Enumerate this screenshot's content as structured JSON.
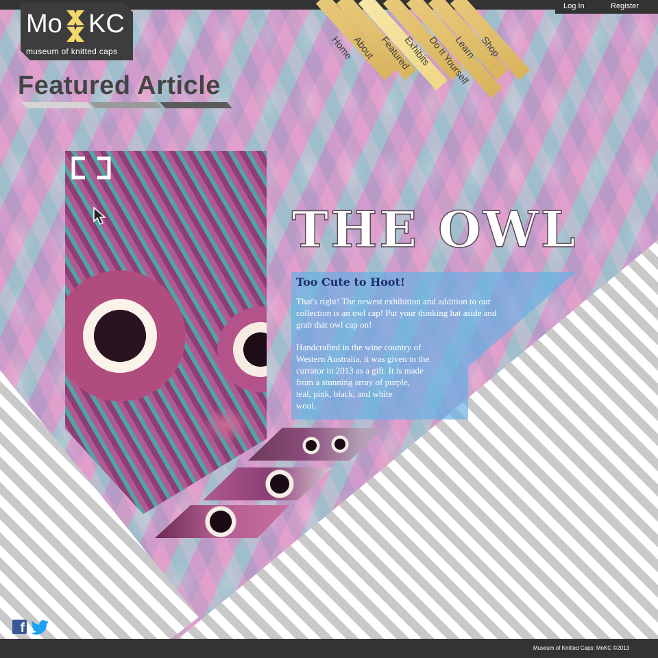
{
  "brand": {
    "logo_left": "Mo",
    "logo_right": "KC",
    "tagline": "museum of knitted caps",
    "accent_color": "#f5d76e",
    "dark_color": "#333333"
  },
  "auth": {
    "login_label": "Log In",
    "register_label": "Register"
  },
  "nav": {
    "items": [
      {
        "label": "Home"
      },
      {
        "label": "About"
      },
      {
        "label": "Featured"
      },
      {
        "label": "Exhibits"
      },
      {
        "label": "Do It Yourself"
      },
      {
        "label": "Learn"
      },
      {
        "label": "Shop"
      }
    ],
    "active": "Featured"
  },
  "page": {
    "heading": "Featured Article"
  },
  "article": {
    "title": "THE OWL",
    "subtitle": "Too Cute to Hoot!",
    "paragraph1": "That's right! The newest exhibition and addition to our collection is an owl cap! Put your thinking hat aside and grab that owl cap on!",
    "paragraph2_lines": [
      "Handcrafted in the wine country of",
      "Western Australia, it was given to the",
      "currator in 2013 as a gift. It is made",
      "from a stunning array of purple,",
      "teal, pink, black, and white",
      "wool."
    ]
  },
  "icons": {
    "fullscreen": "fullscreen-icon",
    "cursor": "cursor-icon",
    "facebook": "facebook-icon",
    "twitter": "twitter-icon"
  },
  "footer": {
    "text": "Museum of Knitted Caps: MoKC ©2013"
  }
}
